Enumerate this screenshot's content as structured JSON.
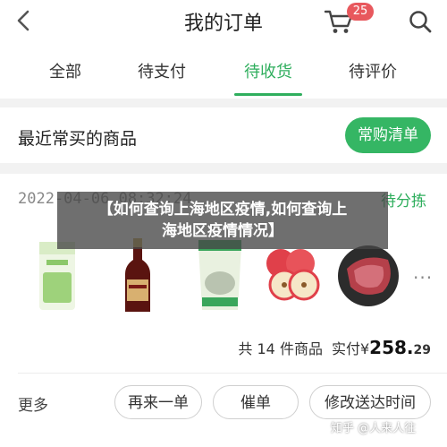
{
  "header": {
    "title": "我的订单",
    "cart_badge": "25",
    "colors": {
      "accent": "#2fae5d",
      "badge": "#e8585d"
    }
  },
  "tabs": [
    {
      "label": "全部"
    },
    {
      "label": "待支付"
    },
    {
      "label": "待收货",
      "active": true
    },
    {
      "label": "待评价"
    }
  ],
  "recent": {
    "title": "最近常买的商品",
    "button_label": "常购清单"
  },
  "order": {
    "datetime": "2022-04-06 08:32:24",
    "status": "待分拣",
    "products": [
      {
        "icon": "milk-powder-bag-icon"
      },
      {
        "icon": "soy-sauce-bottle-icon"
      },
      {
        "icon": "food-package-icon"
      },
      {
        "icon": "apple-icon"
      },
      {
        "icon": "ham-meat-icon"
      }
    ],
    "more": "···",
    "count_text": "共 14 件商品",
    "paid_label": "实付",
    "currency": "¥",
    "price_int": "258.",
    "price_dec": "29",
    "more_link": "更多",
    "buttons": [
      "再来一单",
      "催单",
      "修改送达时间"
    ]
  },
  "overlay": {
    "line1": "【如何查询上海地区疫情,如何查询上",
    "line2": "海地区疫情情况】"
  },
  "watermark": "知乎 @人来人往"
}
